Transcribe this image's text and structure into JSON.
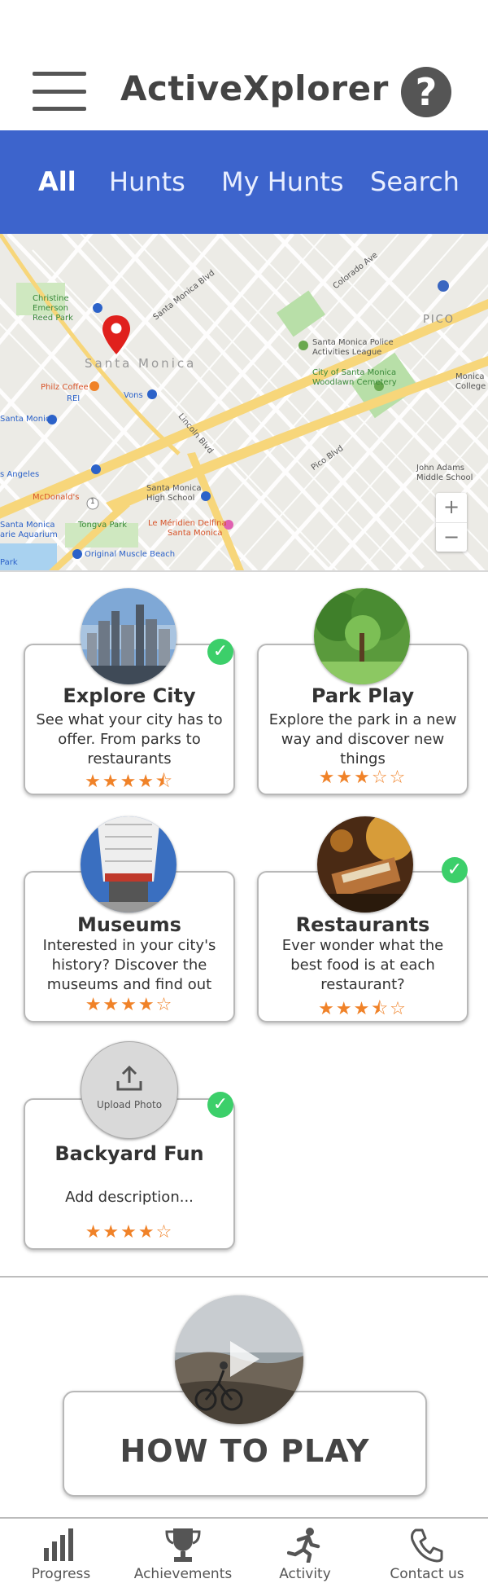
{
  "app": {
    "title": "ActiveXplorer"
  },
  "header": {
    "menu_icon": "hamburger-icon",
    "help_icon": "question-icon",
    "help_glyph": "?"
  },
  "tabs": [
    {
      "label": "All",
      "active": true
    },
    {
      "label": "Hunts",
      "active": false
    },
    {
      "label": "My Hunts",
      "active": false
    },
    {
      "label": "Search",
      "active": false
    }
  ],
  "map": {
    "labels": {
      "christine": "Christine",
      "emerson": "Emerson",
      "reed_park": "Reed Park",
      "santa_monica": "Santa Monica",
      "philz": "Philz Coffee",
      "rei": "REI",
      "vons": "Vons",
      "police": "Santa Monica Police",
      "police2": "Activities League",
      "cemetery": "City of Santa Monica",
      "cemetery2": "Woodlawn Cemetery",
      "pico": "PICO",
      "pico_blvd": "Pico Blvd",
      "lincoln": "Lincoln Blvd",
      "santa_monica_blvd": "Santa Monica Blvd",
      "colorado": "Colorado Ave",
      "santa_monica_high": "Santa Monica",
      "santa_monica_high2": "High School",
      "mcdonalds": "McDonald's",
      "tongva": "Tongva Park",
      "meridien": "Le Méridien Delfina",
      "meridien2": "Santa Monica",
      "aquarium": "arie Aquarium",
      "aquarium_prefix": "Santa Monica",
      "muscle_beach": "Original Muscle Beach",
      "john_adams": "John Adams",
      "john_adams2": "Middle School",
      "angeles": "s Angeles",
      "monica_label": "Santa Monica",
      "park": "Park",
      "college": "Monica",
      "college2": "College",
      "route": "1"
    },
    "zoom_in": "+",
    "zoom_out": "−",
    "accent_road": "#f7d67a",
    "pin_color": "#e0211d"
  },
  "hunts": [
    {
      "title": "Explore City",
      "desc": "See what your city has to offer. From parks to restaurants",
      "rating": 4.5,
      "stars": "★★★★⯪",
      "completed": true,
      "check": "✓"
    },
    {
      "title": "Park Play",
      "desc": "Explore the park in a new way and discover new things",
      "rating": 3,
      "stars": "★★★☆☆",
      "completed": false
    },
    {
      "title": "Museums",
      "desc": "Interested in your city's history? Discover the museums and find out",
      "rating": 4,
      "stars": "★★★★☆",
      "completed": false
    },
    {
      "title": "Restaurants",
      "desc": "Ever wonder what the best food is at each restaurant?",
      "rating": 3.5,
      "stars": "★★★⯪☆",
      "completed": true,
      "check": "✓"
    },
    {
      "title": "Backyard Fun",
      "desc": "Add description...",
      "rating": 4,
      "stars": "★★★★☆",
      "completed": true,
      "check": "✓",
      "upload_label": "Upload Photo"
    }
  ],
  "how_to_play": {
    "label": "HOW TO PLAY"
  },
  "bottom_nav": [
    {
      "label": "Progress",
      "icon": "bar-chart-icon"
    },
    {
      "label": "Achievements",
      "icon": "trophy-icon"
    },
    {
      "label": "Activity",
      "icon": "running-icon"
    },
    {
      "label": "Contact us",
      "icon": "phone-icon"
    }
  ],
  "colors": {
    "tab_bar": "#3d64cc",
    "star": "#f08228",
    "check": "#3ccf6a"
  }
}
